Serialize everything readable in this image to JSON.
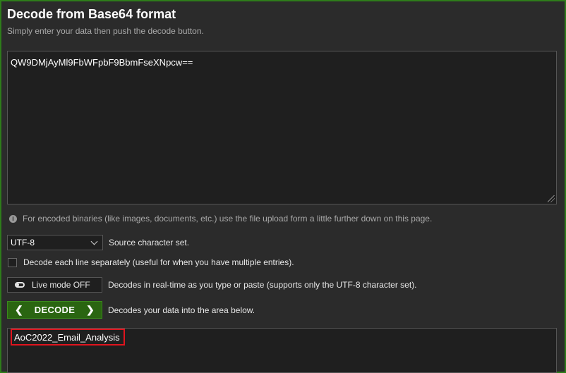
{
  "header": {
    "title": "Decode from Base64 format",
    "subtitle": "Simply enter your data then push the decode button."
  },
  "input": {
    "value": "QW9DMjAyMl9FbWFpbF9BbmFseXNpcw=="
  },
  "info": {
    "icon": "info-icon",
    "text": "For encoded binaries (like images, documents, etc.) use the file upload form a little further down on this page."
  },
  "charset": {
    "selected": "UTF-8",
    "label": "Source character set."
  },
  "decode_lines": {
    "checked": false,
    "label": "Decode each line separately (useful for when you have multiple entries)."
  },
  "live_mode": {
    "button_label": "Live mode OFF",
    "description": "Decodes in real-time as you type or paste (supports only the UTF-8 character set)."
  },
  "decode": {
    "button_label": "DECODE",
    "description": "Decodes your data into the area below."
  },
  "output": {
    "value": "AoC2022_Email_Analysis"
  },
  "colors": {
    "accent_green": "#2a6511",
    "highlight_red": "#e0141e",
    "background": "#2b2b2b"
  }
}
